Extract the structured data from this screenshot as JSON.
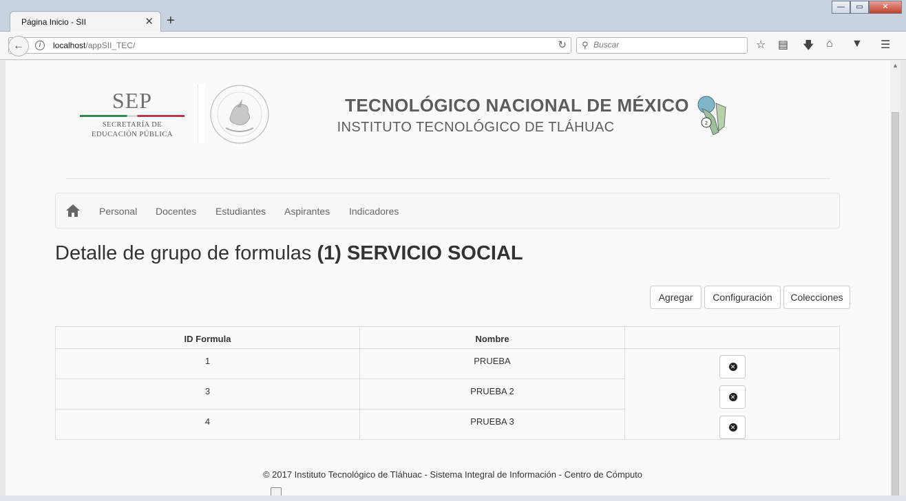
{
  "browser": {
    "tab_title": "Página Inicio - SII",
    "tab_close": "✕",
    "new_tab": "+",
    "url_host": "localhost",
    "url_path": "/appSII_TEC/",
    "search_placeholder": "Buscar",
    "window_controls": {
      "minimize": "—",
      "maximize": "▭",
      "close": "✕"
    },
    "toolbar_icons": [
      "star-icon",
      "reading-list-icon",
      "download-icon",
      "home-icon",
      "pocket-icon",
      "menu-icon"
    ]
  },
  "header": {
    "sep_title": "SEP",
    "sep_subtitle_line1": "SECRETARÍA DE",
    "sep_subtitle_line2": "EDUCACIÓN PÚBLICA",
    "institution_title": "TECNOLÓGICO NACIONAL DE MÉXICO",
    "institution_subtitle": "INSTITUTO TECNOLÓGICO DE TLÁHUAC"
  },
  "menu": {
    "items": [
      {
        "label": "Personal"
      },
      {
        "label": "Docentes"
      },
      {
        "label": "Estudiantes"
      },
      {
        "label": "Aspirantes"
      },
      {
        "label": "Indicadores"
      }
    ]
  },
  "page": {
    "heading_prefix": "Detalle de grupo de formulas",
    "heading_bold": "(1) SERVICIO SOCIAL"
  },
  "actions": {
    "add_label": "Agregar",
    "config_label": "Configuración",
    "collections_label": "Colecciones"
  },
  "table": {
    "headers": [
      "ID Formula",
      "Nombre",
      ""
    ],
    "rows": [
      {
        "id": "1",
        "name": "PRUEBA"
      },
      {
        "id": "3",
        "name": "PRUEBA 2"
      },
      {
        "id": "4",
        "name": "PRUEBA 3"
      }
    ]
  },
  "footer": {
    "text": "© 2017 Instituto Tecnológico de Tláhuac - Sistema Integral de Información - Centro de Cómputo"
  },
  "colors": {
    "sep_green": "#2f8b52",
    "sep_red": "#b9394a",
    "heading_gray": "#5c5c5c",
    "text": "#333333"
  }
}
